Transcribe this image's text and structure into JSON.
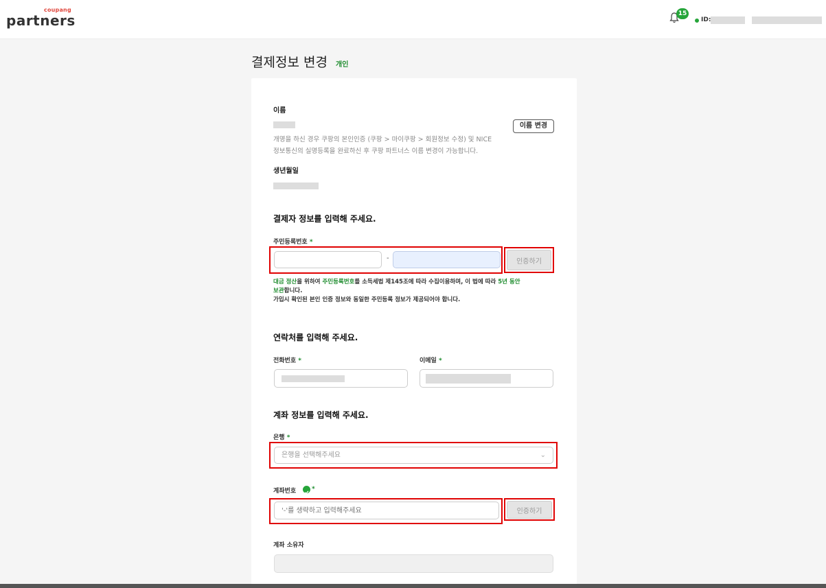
{
  "header": {
    "logo_small": "coupang",
    "logo_big": "partners",
    "notification_count": "15",
    "id_label": "ID:"
  },
  "page": {
    "title": "결제정보 변경",
    "tag": "개인"
  },
  "name_section": {
    "label": "이름",
    "change_button": "이름 변경",
    "note_line1": "개명을 하신 경우 쿠팡의 본인인증 (쿠팡 > 마이쿠팡 > 회원정보 수정) 및 NICE",
    "note_line2": "정보통신의 실명등록을 완료하신 후 쿠팡 파트너스 이름 변경이 가능합니다.",
    "birth_label": "생년월일"
  },
  "payer_section": {
    "title": "결제자 정보를 입력해 주세요.",
    "rrn_label": "주민등록번호",
    "required_mark": "*",
    "dash": "-",
    "verify_button": "인증하기",
    "legal_part1": "대금 정산",
    "legal_part2": "을 위하여 ",
    "legal_part3": "주민등록번호",
    "legal_part4": "를 소득세법 제145조에 따라 수집이용하며, 이 법에 따라 ",
    "legal_part5": "5년 동안",
    "legal_line2_green": "보관",
    "legal_line2_rest": "합니다.",
    "legal_line3": "가입시 확인된 본인 인증 정보와 동일한 주민등록 정보가 제공되어야 합니다."
  },
  "contact_section": {
    "title": "연락처를 입력해 주세요.",
    "phone_label": "전화번호",
    "email_label": "이메일",
    "required_mark": "*"
  },
  "account_section": {
    "title": "계좌 정보를 입력해 주세요.",
    "bank_label": "은행",
    "bank_placeholder": "은행을 선택해주세요",
    "account_label": "계좌번호",
    "account_placeholder": "'-'를 생략하고 입력해주세요",
    "verify_button": "인증하기",
    "owner_label": "계좌 소유자",
    "required_mark": "*"
  },
  "colors": {
    "accent": "#1e8c2e",
    "highlight": "#e00000"
  }
}
